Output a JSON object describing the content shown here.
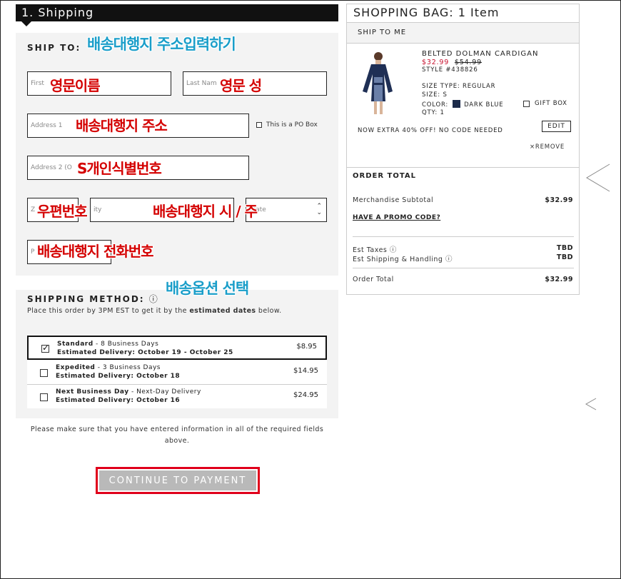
{
  "checkout": {
    "step_title": "1. Shipping",
    "ship_to_label": "SHIP TO:",
    "fields": {
      "first_name": "First",
      "last_name": "Last Nam",
      "address1": "Address 1",
      "po_box_label": "This is a PO Box",
      "address2": "Address 2 (O",
      "zip": "Z",
      "city": "ity",
      "state": "State",
      "phone": "P"
    },
    "overlays": {
      "ship_to": "배송대행지 주소입력하기",
      "first_name": "영문이름",
      "last_name": "영문 성",
      "address1": "배송대행지 주소",
      "address2": "S개인식별번호",
      "zip": "우편번호",
      "city_state": "배송대행지 시 / 주",
      "phone": "배송대행지 전화번호",
      "shipping": "배송옵션 선택"
    },
    "shipping_method": {
      "title": "SHIPPING METHOD:",
      "info_icon": "ⓘ",
      "note_prefix": "Place this order by 3PM EST to get it by the ",
      "note_bold": "estimated dates",
      "note_suffix": " below.",
      "options": [
        {
          "name": "Standard",
          "sep": " - ",
          "days": "8 Business Days",
          "eta": "Estimated Delivery: October 19 - October 25",
          "price": "$8.95",
          "checked": true
        },
        {
          "name": "Expedited",
          "sep": " - ",
          "days": "3 Business Days",
          "eta": "Estimated Delivery: October 18",
          "price": "$14.95",
          "checked": false
        },
        {
          "name": "Next Business Day",
          "sep": " - ",
          "days": "Next-Day Delivery",
          "eta": "Estimated Delivery: October 16",
          "price": "$24.95",
          "checked": false
        }
      ]
    },
    "required_note": "Please make sure that you have entered information in all of the required fields above.",
    "continue_label": "CONTINUE TO PAYMENT"
  },
  "bag": {
    "title": "SHOPPING BAG: 1 Item",
    "ship_to_me": "SHIP TO ME",
    "product": {
      "name": "BELTED DOLMAN CARDIGAN",
      "sale_price": "$32.99",
      "orig_price": "$54.99",
      "style": "STYLE #438826",
      "size_type": "SIZE TYPE: REGULAR",
      "size": "SIZE: S",
      "color_label": "COLOR:",
      "color_name": "DARK BLUE",
      "color_hex": "#1c2b4a",
      "qty": "QTY: 1",
      "gift_box": "GIFT BOX",
      "promo": "NOW EXTRA 40% OFF! NO CODE NEEDED",
      "edit": "EDIT",
      "remove": "×REMOVE"
    },
    "order_total": {
      "title": "ORDER TOTAL",
      "subtotal_label": "Merchandise Subtotal",
      "subtotal_value": "$32.99",
      "promo_link": "HAVE A PROMO CODE?",
      "taxes_label": "Est Taxes ⓘ",
      "taxes_value": "TBD",
      "shipping_label": "Est Shipping & Handling  ⓘ",
      "shipping_value": "TBD",
      "total_label": "Order Total",
      "total_value": "$32.99"
    }
  },
  "colors": {
    "accent_red": "#e0001b",
    "sale_red": "#c8102e",
    "overlay_red": "#d40000",
    "overlay_blue": "#1a9ec9"
  }
}
